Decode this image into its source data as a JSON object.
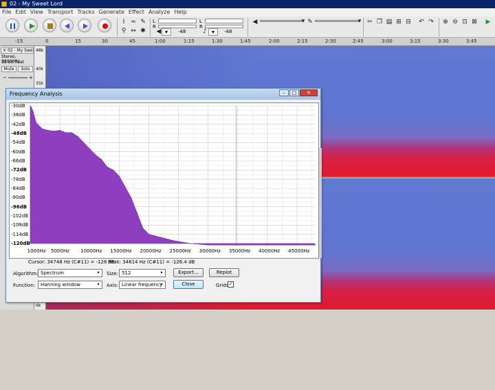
{
  "window": {
    "title": "02 - My Sweet Lord"
  },
  "menu": [
    "File",
    "Edit",
    "View",
    "Transport",
    "Tracks",
    "Generate",
    "Effect",
    "Analyze",
    "Help"
  ],
  "toolbar": {
    "meter_left_label": "L",
    "meter_right_label": "R",
    "meter_left_value": "-48",
    "meter_right_value": "-48",
    "meter_l": "L",
    "meter_r": "R"
  },
  "ruler": {
    "ticks": [
      "-15",
      "0",
      "15",
      "30",
      "45",
      "1:00",
      "1:15",
      "1:30",
      "1:45",
      "2:00",
      "2:15",
      "2:30",
      "2:45",
      "3:00",
      "3:15",
      "3:30",
      "3:45"
    ]
  },
  "track": {
    "name": "02 - My Swe",
    "rate": "Stereo, 96000Hz",
    "format": "32-bit float",
    "mute": "Mute",
    "solo": "Solo"
  },
  "db_scale": [
    "48k",
    "40k",
    "35k",
    "0k"
  ],
  "dialog": {
    "title": "Frequency Analysis",
    "cursor_info": "Cursor: 34748 Hz (C#11) = -126 dB",
    "peak_info": "Peak: 34614 Hz (C#11) = -126.4 dB",
    "algorithm_label": "Algorithm:",
    "algorithm_value": "Spectrum",
    "size_label": "Size:",
    "size_value": "512",
    "function_label": "Function:",
    "function_value": "Hanning window",
    "axis_label": "Axis:",
    "axis_value": "Linear frequency",
    "export_label": "Export...",
    "replot_label": "Replot",
    "close_label": "Close",
    "grids_label": "Grids",
    "grids_checked": true
  },
  "chart_data": {
    "type": "area",
    "x": [
      0,
      200,
      500,
      1000,
      2000,
      3000,
      4000,
      5000,
      6000,
      7000,
      8000,
      9000,
      10000,
      11000,
      12000,
      13000,
      14000,
      15000,
      16000,
      17000,
      18000,
      19000,
      20000,
      21000,
      22000,
      24000,
      27000,
      30000,
      35000,
      40000,
      45000,
      48000
    ],
    "y": [
      -30,
      -31,
      -34,
      -41,
      -45,
      -46,
      -46.5,
      -46,
      -47.5,
      -47.5,
      -50,
      -54,
      -58,
      -62,
      -65,
      -70,
      -72,
      -76,
      -83,
      -90,
      -100,
      -110,
      -114,
      -115,
      -116,
      -118,
      -120,
      -121,
      -121,
      -121,
      -121,
      -121
    ],
    "y_tick_labels": [
      "-30dB",
      "-36dB",
      "-42dB",
      "-48dB",
      "-54dB",
      "-60dB",
      "-66dB",
      "-72dB",
      "-78dB",
      "-84dB",
      "-90dB",
      "-96dB",
      "-102dB",
      "-108dB",
      "-114dB",
      "-120dB"
    ],
    "y_bold_ticks": [
      "-48dB",
      "-72dB",
      "-96dB",
      "-120dB"
    ],
    "x_tick_labels": [
      "1000Hz",
      "5000Hz",
      "10000Hz",
      "15000Hz",
      "20000Hz",
      "25000Hz",
      "30000Hz",
      "35000Hz",
      "40000Hz",
      "45000Hz"
    ],
    "x_tick_values": [
      1000,
      5000,
      10000,
      15000,
      20000,
      25000,
      30000,
      35000,
      40000,
      45000
    ],
    "xlim": [
      0,
      48000
    ],
    "ylim": [
      -120,
      -30
    ],
    "grid": true,
    "fill_color": "#8e3fc0"
  }
}
